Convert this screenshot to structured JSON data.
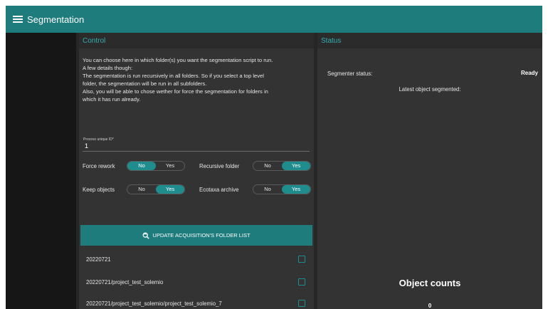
{
  "app": {
    "title": "Segmentation",
    "menu_icon": "hamburger-menu-icon",
    "accent_color": "#1e7c7d"
  },
  "control": {
    "header": "Control",
    "description": [
      "You can choose here in which folder(s) you want the segmentation script to run.",
      "A few details though:",
      "The segmentation is run recursively in all folders. So if you select a top level",
      "folder, the segmentation will be run in all subfolders.",
      "Also, you will be able to chose wether for force the segmentation for folders in",
      "which it has run already."
    ],
    "process_id": {
      "label": "Process unique ID*",
      "value": "1"
    },
    "toggles": {
      "force_rework": {
        "label": "Force rework",
        "no": "No",
        "yes": "Yes",
        "selected": "No"
      },
      "recursive_folder": {
        "label": "Recursive folder",
        "no": "No",
        "yes": "Yes",
        "selected": "Yes"
      },
      "keep_objects": {
        "label": "Keep objects",
        "no": "No",
        "yes": "Yes",
        "selected": "Yes"
      },
      "ecotaxa_archive": {
        "label": "Ecotaxa archive",
        "no": "No",
        "yes": "Yes",
        "selected": "Yes"
      }
    },
    "update_button": {
      "label": "UPDATE ACQUISITION'S FOLDER LIST",
      "icon": "refresh-search-icon"
    },
    "folders": [
      {
        "path": "20220721",
        "checked": false
      },
      {
        "path": "20220721/project_test_solemio",
        "checked": false
      },
      {
        "path": "20220721/project_test_solemio/project_test_solemio_7",
        "checked": false
      }
    ]
  },
  "status": {
    "header": "Status",
    "segmenter_label": "Segmenter status:",
    "segmenter_value": "Ready",
    "latest_label": "Latest object segmented:",
    "counts_title": "Object counts",
    "counts_value": "0"
  }
}
